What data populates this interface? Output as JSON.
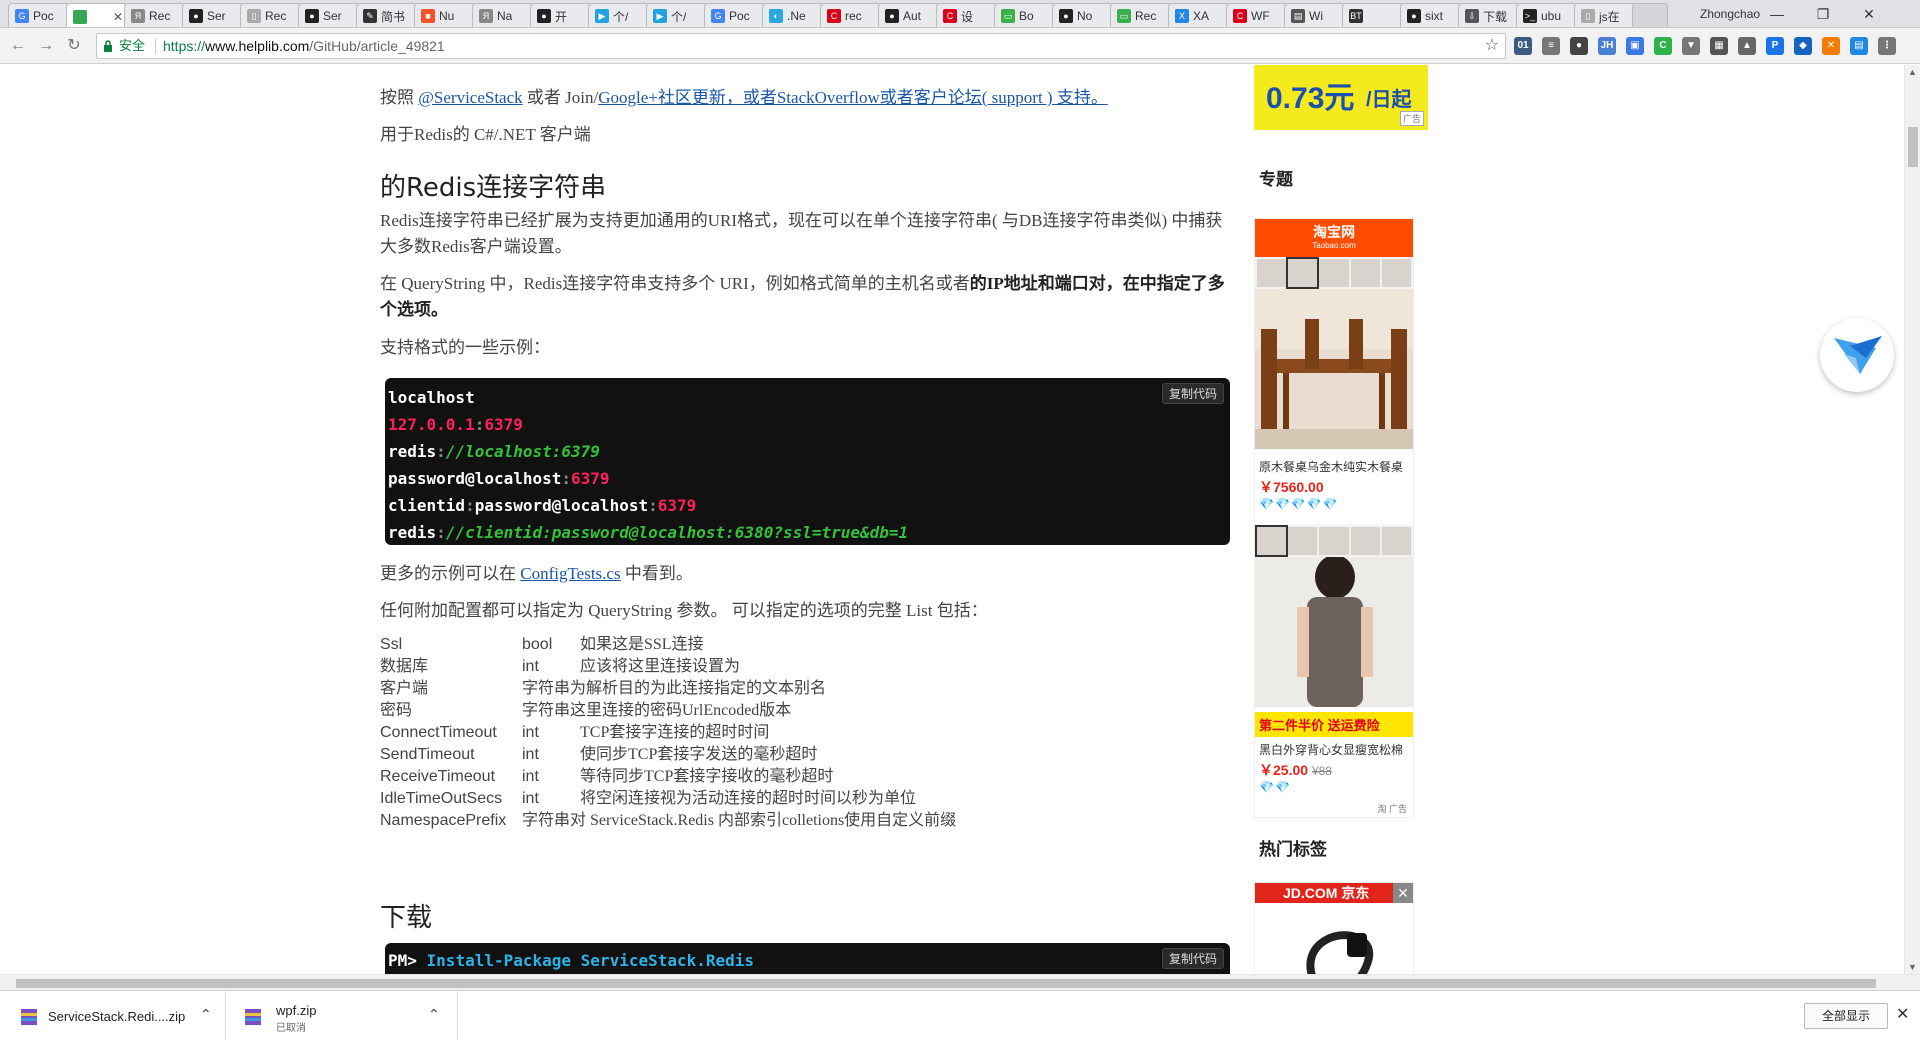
{
  "browser": {
    "tabs": [
      {
        "label": "Poc",
        "color": "#4285f4",
        "glyph": "G"
      },
      {
        "label": "",
        "color": "#34a853",
        "glyph": ""
      },
      {
        "label": "Rec",
        "color": "#888888",
        "glyph": "Я"
      },
      {
        "label": "Ser",
        "color": "#222222",
        "glyph": "●"
      },
      {
        "label": "Rec",
        "color": "#aaaaaa",
        "glyph": "▯"
      },
      {
        "label": "Ser",
        "color": "#222222",
        "glyph": "●"
      },
      {
        "label": "简书",
        "color": "#333333",
        "glyph": "✎"
      },
      {
        "label": "Nu",
        "color": "#f35325",
        "glyph": "■"
      },
      {
        "label": "Na",
        "color": "#888888",
        "glyph": "Я"
      },
      {
        "label": "开",
        "color": "#222222",
        "glyph": "●"
      },
      {
        "label": "个/",
        "color": "#22a3e0",
        "glyph": "▶"
      },
      {
        "label": "个/",
        "color": "#22a3e0",
        "glyph": "▶"
      },
      {
        "label": "Poc",
        "color": "#4285f4",
        "glyph": "G"
      },
      {
        "label": ".Ne",
        "color": "#29a9e0",
        "glyph": "◐"
      },
      {
        "label": "rec",
        "color": "#d9001b",
        "glyph": "C"
      },
      {
        "label": "Aut",
        "color": "#222222",
        "glyph": "●"
      },
      {
        "label": "设",
        "color": "#d9001b",
        "glyph": "C"
      },
      {
        "label": "Bo",
        "color": "#3bb04a",
        "glyph": "▭"
      },
      {
        "label": "No",
        "color": "#222222",
        "glyph": "●"
      },
      {
        "label": "Rec",
        "color": "#3bb04a",
        "glyph": "▭"
      },
      {
        "label": "XA",
        "color": "#1e88e5",
        "glyph": "X"
      },
      {
        "label": "WF",
        "color": "#d9001b",
        "glyph": "C"
      },
      {
        "label": "Wi",
        "color": "#555555",
        "glyph": "▤"
      },
      {
        "label": "",
        "color": "#333333",
        "glyph": "BT"
      },
      {
        "label": "sixt",
        "color": "#222222",
        "glyph": "●"
      },
      {
        "label": "下载",
        "color": "#555555",
        "glyph": "⇩"
      },
      {
        "label": "ubu",
        "color": "#222222",
        "glyph": ">_"
      },
      {
        "label": "js在",
        "color": "#aaaaaa",
        "glyph": "▯"
      }
    ],
    "close_glyph": "✕",
    "profile_name": "Zhongchao",
    "window_controls": [
      "—",
      "❐",
      "✕"
    ],
    "secure_label": "安全",
    "url_scheme": "https://",
    "url_host": "www.helplib.com",
    "url_path": "/GitHub/article_49821",
    "extensions": [
      {
        "glyph": "01",
        "color": "#3d5a80"
      },
      {
        "glyph": "≡",
        "color": "#777777"
      },
      {
        "glyph": "●",
        "color": "#444444"
      },
      {
        "glyph": "JH",
        "color": "#4a7fd6"
      },
      {
        "glyph": "▣",
        "color": "#3b78e7"
      },
      {
        "glyph": "C",
        "color": "#2bb24c"
      },
      {
        "glyph": "▼",
        "color": "#777777"
      },
      {
        "glyph": "▦",
        "color": "#555555"
      },
      {
        "glyph": "▲",
        "color": "#666666"
      },
      {
        "glyph": "P",
        "color": "#1a73e8"
      },
      {
        "glyph": "◆",
        "color": "#1565c0"
      },
      {
        "glyph": "✕",
        "color": "#f57c00"
      },
      {
        "glyph": "▤",
        "color": "#1e88e5"
      },
      {
        "glyph": "⋮",
        "color": "#777777"
      }
    ]
  },
  "article": {
    "intro1": {
      "prefix": "按照 ",
      "link1": "@ServiceStack",
      "mid": " 或者 Join/",
      "link2": "Google+社区更新，或者StackOverflow或者客户论坛( support ) 支持。"
    },
    "intro2": "用于Redis的 C#/.NET 客户端",
    "heading_conn": "的Redis连接字符串",
    "para1": "Redis连接字符串已经扩展为支持更加通用的URI格式，现在可以在单个连接字符串( 与DB连接字符串类似) 中捕获大多数Redis客户端设置。",
    "para2_normal": "在 QueryString 中，Redis连接字符串支持多个 URI，例如格式简单的主机名或者",
    "para2_bold": "的IP地址和端口对，在中指定了多个选项。",
    "para3": "支持格式的一些示例：",
    "copy_label": "复制代码",
    "code_lines": [
      [
        {
          "t": "localhost",
          "c": "w"
        }
      ],
      [
        {
          "t": "127.0.0.1",
          "c": "r"
        },
        {
          "t": ":",
          "c": "gr"
        },
        {
          "t": "6379",
          "c": "r"
        }
      ],
      [
        {
          "t": "redis",
          "c": "w"
        },
        {
          "t": ":",
          "c": "gr"
        },
        {
          "t": "//localhost:6379",
          "c": "g"
        }
      ],
      [
        {
          "t": "password@localhost",
          "c": "w"
        },
        {
          "t": ":",
          "c": "gr"
        },
        {
          "t": "6379",
          "c": "r"
        }
      ],
      [
        {
          "t": "clientid",
          "c": "w"
        },
        {
          "t": ":",
          "c": "gr"
        },
        {
          "t": "password@localhost",
          "c": "w"
        },
        {
          "t": ":",
          "c": "gr"
        },
        {
          "t": "6379",
          "c": "r"
        }
      ],
      [
        {
          "t": "redis",
          "c": "w"
        },
        {
          "t": ":",
          "c": "gr"
        },
        {
          "t": "//clientid:password@localhost:6380?ssl=true&db=1",
          "c": "g"
        }
      ]
    ],
    "more_prefix": "更多的示例可以在 ",
    "more_link": "ConfigTests.cs",
    "more_suffix": " 中看到。",
    "options_intro": "任何附加配置都可以指定为 QueryString 参数。 可以指定的选项的完整 List 包括：",
    "options": [
      {
        "name": "Ssl",
        "type": "bool",
        "desc": "如果这是SSL连接"
      },
      {
        "name": "数据库",
        "type": "int",
        "desc": "应该将这里连接设置为"
      },
      {
        "name": "客户端",
        "type": "",
        "desc": "字符串为解析目的为此连接指定的文本别名"
      },
      {
        "name": "密码",
        "type": "",
        "desc": "字符串这里连接的密码UrlEncoded版本"
      },
      {
        "name": "ConnectTimeout",
        "type": "int",
        "desc": "TCP套接字连接的超时时间"
      },
      {
        "name": "SendTimeout",
        "type": "int",
        "desc": "使同步TCP套接字发送的毫秒超时"
      },
      {
        "name": "ReceiveTimeout",
        "type": "int",
        "desc": "等待同步TCP套接字接收的毫秒超时"
      },
      {
        "name": "IdleTimeOutSecs",
        "type": "int",
        "desc": "将空闲连接视为活动连接的超时时间以秒为单位"
      },
      {
        "name": "NamespacePrefix",
        "type": "",
        "desc": "字符串对 ServiceStack.Redis 内部索引colletions使用自定义前缀"
      }
    ],
    "heading_download": "下载",
    "pm_prompt": "PM>",
    "pm_command": " Install-Package ServiceStack.Redis"
  },
  "sidebar": {
    "price_ad": {
      "price": "0.73元",
      "unit": "/日起",
      "tag": "广告"
    },
    "topics_heading": "专题",
    "taobao": {
      "brand": "淘宝网",
      "brand_sub": "Taobao.com",
      "products": [
        {
          "name": "原木餐桌乌金木纯实木餐桌",
          "price": "￥7560.00",
          "old_price": "",
          "gems": "💎💎💎💎💎"
        },
        {
          "name": "黑白外穿背心女显瘦宽松棉",
          "price": "￥25.00",
          "old_price": "¥88",
          "gems": "💎💎",
          "promo": "第二件半价 送运费险"
        }
      ],
      "ad_tag": "淘 广告"
    },
    "tags_heading": "热门标签",
    "jd": {
      "brand": "JD.COM 京东",
      "close": "✕"
    }
  },
  "downloads": [
    {
      "name": "ServiceStack.Redi....zip",
      "status": ""
    },
    {
      "name": "wpf.zip",
      "status": "已取消"
    }
  ],
  "download_show_all": "全部显示",
  "download_close": "✕"
}
